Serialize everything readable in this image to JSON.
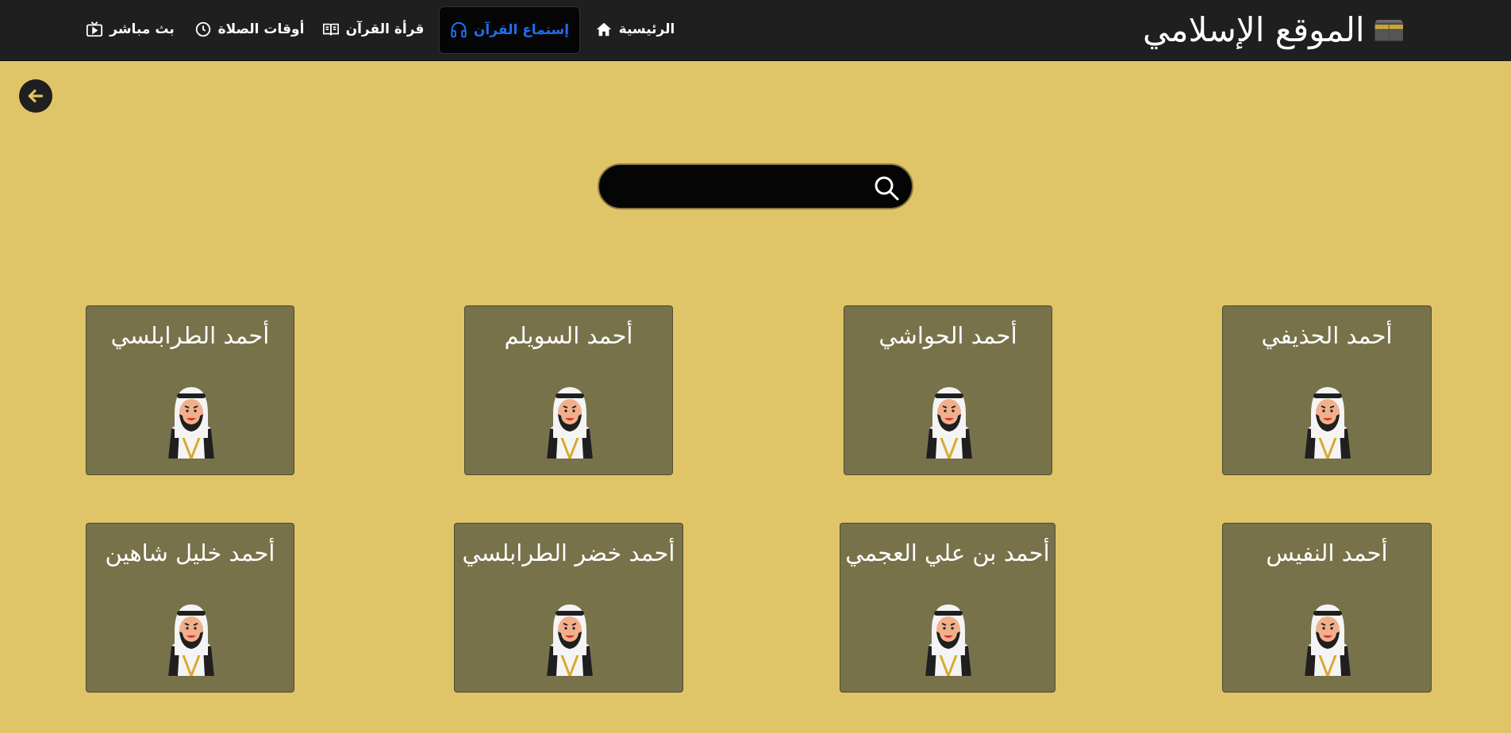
{
  "navbar": {
    "brand": "الموقع الإسلامي",
    "brand_icon": "kaaba-icon",
    "items": [
      {
        "label": "الرئيسية",
        "icon": "home-icon"
      },
      {
        "label": "إستماع القرآن",
        "icon": "headphones-icon",
        "active": true
      },
      {
        "label": "قرأة القرآن",
        "icon": "book-icon"
      },
      {
        "label": "أوقات الصلاة",
        "icon": "clock-icon"
      },
      {
        "label": "بث مباشر",
        "icon": "tv-icon"
      }
    ],
    "active_color": "#1e6ff0"
  },
  "back_button": {
    "icon": "arrow-left-icon"
  },
  "search": {
    "placeholder": "",
    "value": "",
    "icon": "search-icon"
  },
  "reciters": [
    {
      "name": "أحمد الحذيفي"
    },
    {
      "name": "أحمد الحواشي"
    },
    {
      "name": "أحمد السويلم"
    },
    {
      "name": "أحمد الطرابلسي"
    },
    {
      "name": "أحمد النفيس"
    },
    {
      "name": "أحمد بن علي العجمي"
    },
    {
      "name": "أحمد خضر الطرابلسي"
    },
    {
      "name": "أحمد خليل شاهين"
    }
  ],
  "colors": {
    "background": "#e0c468",
    "card": "#78724a",
    "navbar": "#1f1f1f"
  }
}
